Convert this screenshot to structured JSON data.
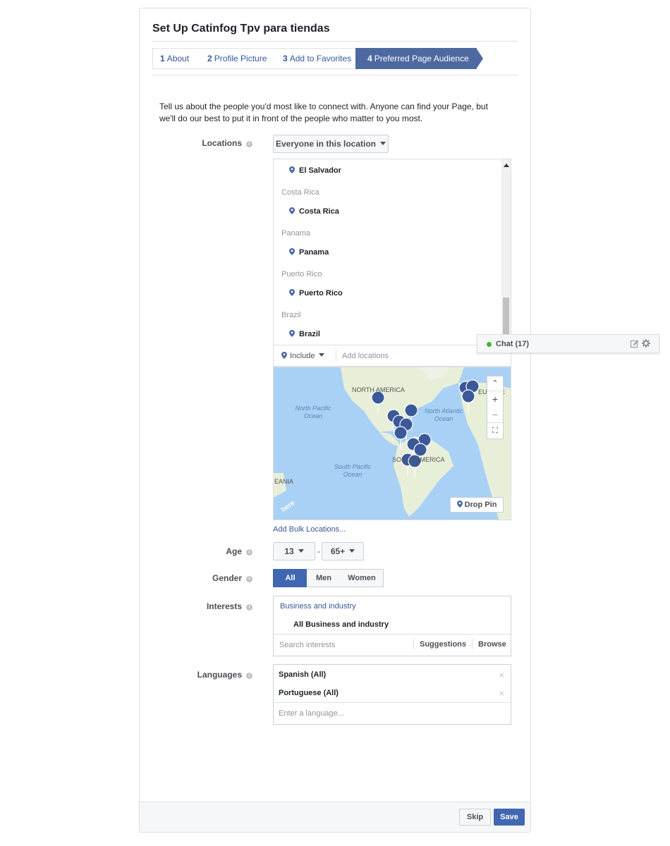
{
  "dialog": {
    "title": "Set Up Catinfog Tpv para tiendas",
    "steps": [
      {
        "num": "1",
        "label": "About"
      },
      {
        "num": "2",
        "label": "Profile Picture"
      },
      {
        "num": "3",
        "label": "Add to Favorites"
      },
      {
        "num": "4",
        "label": "Preferred Page Audience"
      }
    ],
    "intro": "Tell us about the people you'd most like to connect with. Anyone can find your Page, but we'll do our best to put it in front of the people who matter to you most."
  },
  "locations": {
    "label": "Locations",
    "dropdown": "Everyone in this location",
    "selected_top": "El Salvador",
    "groups": [
      {
        "country": "Costa Rica",
        "item": "Costa Rica"
      },
      {
        "country": "Panama",
        "item": "Panama"
      },
      {
        "country": "Puerto Rico",
        "item": "Puerto Rico"
      },
      {
        "country": "Brazil",
        "item": "Brazil"
      }
    ],
    "include_label": "Include",
    "add_placeholder": "Add locations",
    "bulk_link": "Add Bulk Locations..."
  },
  "map": {
    "labels": {
      "north_america": "NORTH AMERICA",
      "europe": "EUROPE",
      "south_america": "SOUTH AMERICA",
      "north_pacific": "North Pacific Ocean",
      "north_atlantic": "North Atlantic Ocean",
      "south_pacific": "South Pacific Ocean",
      "oceania": "EANIA",
      "here": "here"
    },
    "zoom_in": "+",
    "zoom_out": "−",
    "drop_pin": "Drop Pin",
    "pin_color": "#3b5998",
    "water_color": "#a9d1f5",
    "land_color": "#e8efd8"
  },
  "age": {
    "label": "Age",
    "min": "13",
    "max": "65+",
    "sep": "-"
  },
  "gender": {
    "label": "Gender",
    "options": [
      "All",
      "Men",
      "Women"
    ],
    "selected": "All"
  },
  "interests": {
    "label": "Interests",
    "category": "Business and industry",
    "item": "All Business and industry",
    "search_placeholder": "Search interests",
    "suggestions": "Suggestions",
    "browse": "Browse"
  },
  "languages": {
    "label": "Languages",
    "items": [
      "Spanish (All)",
      "Portuguese (All)"
    ],
    "remove_glyph": "×",
    "placeholder": "Enter a language..."
  },
  "footer": {
    "skip": "Skip",
    "save": "Save"
  },
  "chat": {
    "label": "Chat (17)",
    "status_color": "#42b72a"
  },
  "info_glyph": "i",
  "colors": {
    "brand": "#4267b2",
    "step_active": "#4e69a2",
    "link": "#365899"
  }
}
